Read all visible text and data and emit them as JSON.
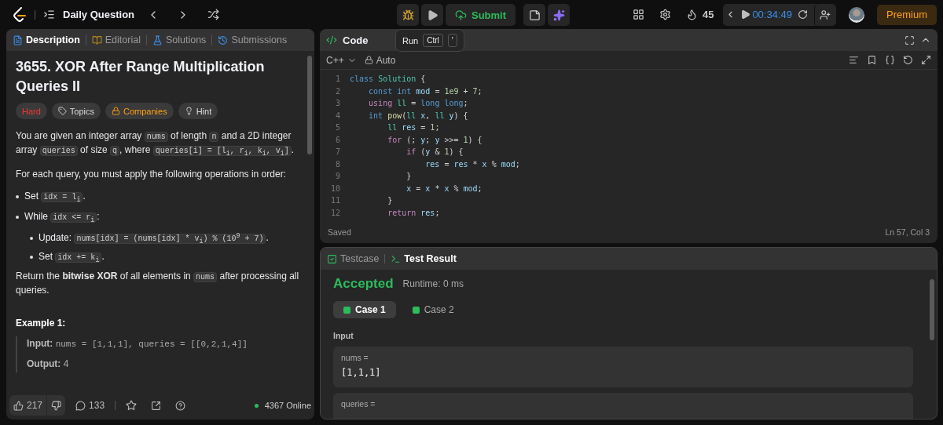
{
  "topbar": {
    "title": "Daily Question",
    "submit": "Submit",
    "streak": "45",
    "timer": "00:34:49",
    "premium": "Premium"
  },
  "tooltip": {
    "label": "Run",
    "keys": [
      "Ctrl",
      "'"
    ]
  },
  "left": {
    "tabs": [
      {
        "label": "Description",
        "selected": true,
        "kind": "description"
      },
      {
        "label": "Editorial",
        "selected": false,
        "kind": "editorial"
      },
      {
        "label": "Solutions",
        "selected": false,
        "kind": "solutions"
      },
      {
        "label": "Submissions",
        "selected": false,
        "kind": "submissions"
      }
    ],
    "title": "3655. XOR After Range Multiplication Queries II",
    "tags": [
      {
        "label": "Hard",
        "kind": "difficulty"
      },
      {
        "label": "Topics",
        "kind": "topics"
      },
      {
        "label": "Companies",
        "kind": "companies"
      },
      {
        "label": "Hint",
        "kind": "hint"
      }
    ],
    "blocks": [
      {
        "kind": "p",
        "segments": [
          {
            "kind": "text",
            "text": "You are given an integer array "
          },
          {
            "kind": "code",
            "text": "nums"
          },
          {
            "kind": "text",
            "text": " of length "
          },
          {
            "kind": "code",
            "text": "n"
          },
          {
            "kind": "text",
            "text": " and a 2D integer array "
          },
          {
            "kind": "code",
            "text": "queries"
          },
          {
            "kind": "text",
            "text": " of size "
          },
          {
            "kind": "code",
            "text": "q"
          },
          {
            "kind": "text",
            "text": ", where "
          },
          {
            "kind": "code",
            "text": "queries[i] = [l$_{i}$, r$_{i}$, k$_{i}$, v$_{i}$]"
          },
          {
            "kind": "text",
            "text": "."
          }
        ]
      },
      {
        "kind": "p",
        "segments": [
          {
            "kind": "text",
            "text": "For each query, you must apply the following operations in order:"
          }
        ]
      },
      {
        "kind": "bullet",
        "segments": [
          {
            "kind": "text",
            "text": "Set "
          },
          {
            "kind": "code",
            "text": "idx = l$_{i}$"
          },
          {
            "kind": "text",
            "text": "."
          }
        ]
      },
      {
        "kind": "bullet",
        "segments": [
          {
            "kind": "text",
            "text": "While "
          },
          {
            "kind": "code",
            "text": "idx <= r$_{i}$"
          },
          {
            "kind": "text",
            "text": ":"
          }
        ],
        "children": [
          {
            "kind": "bullet",
            "segments": [
              {
                "kind": "text",
                "text": "Update: "
              },
              {
                "kind": "code",
                "text": "nums[idx] = (nums[idx] * v$_{i}$) % (10$^{9}$ + 7)"
              },
              {
                "kind": "text",
                "text": "."
              }
            ]
          },
          {
            "kind": "bullet",
            "segments": [
              {
                "kind": "text",
                "text": "Set "
              },
              {
                "kind": "code",
                "text": "idx += k$_{i}$"
              },
              {
                "kind": "text",
                "text": "."
              }
            ]
          }
        ]
      },
      {
        "kind": "p",
        "segments": [
          {
            "kind": "text",
            "text": "Return the **bitwise XOR** of all elements in "
          },
          {
            "kind": "code",
            "text": "nums"
          },
          {
            "kind": "text",
            "text": " after processing all queries."
          }
        ]
      }
    ],
    "example": {
      "title": "Example 1:",
      "lines": [
        {
          "label": "Input:",
          "value": "nums = [1,1,1], queries = [[0,2,1,4]]",
          "kind": "mono"
        },
        {
          "label": "Output:",
          "value": "4",
          "kind": "plain"
        }
      ]
    },
    "footer": {
      "likes": "217",
      "comments": "133",
      "online": "4367 Online"
    }
  },
  "code": {
    "title": "Code",
    "language": "C++",
    "mode": "Auto",
    "lines": [
      {
        "n": "1",
        "tokens": [
          {
            "kind": "kw",
            "text": "class "
          },
          {
            "kind": "type",
            "text": "Solution"
          },
          {
            "kind": "plain",
            "text": " {"
          }
        ]
      },
      {
        "n": "2",
        "tokens": [
          {
            "kind": "kw",
            "text": "    const int "
          },
          {
            "kind": "var",
            "text": "mod"
          },
          {
            "kind": "plain",
            "text": " = "
          },
          {
            "kind": "num",
            "text": "1e9"
          },
          {
            "kind": "plain",
            "text": " + "
          },
          {
            "kind": "num",
            "text": "7"
          },
          {
            "kind": "plain",
            "text": ";"
          }
        ]
      },
      {
        "n": "3",
        "tokens": [
          {
            "kind": "ctl",
            "text": "    using "
          },
          {
            "kind": "type",
            "text": "ll"
          },
          {
            "kind": "plain",
            "text": " = "
          },
          {
            "kind": "kw",
            "text": "long long"
          },
          {
            "kind": "plain",
            "text": ";"
          }
        ]
      },
      {
        "n": "4",
        "tokens": [
          {
            "kind": "kw",
            "text": "    int "
          },
          {
            "kind": "fn",
            "text": "pow"
          },
          {
            "kind": "plain",
            "text": "("
          },
          {
            "kind": "type",
            "text": "ll "
          },
          {
            "kind": "var",
            "text": "x"
          },
          {
            "kind": "plain",
            "text": ", "
          },
          {
            "kind": "type",
            "text": "ll "
          },
          {
            "kind": "var",
            "text": "y"
          },
          {
            "kind": "plain",
            "text": ") {"
          }
        ]
      },
      {
        "n": "5",
        "tokens": [
          {
            "kind": "type",
            "text": "        ll "
          },
          {
            "kind": "var",
            "text": "res"
          },
          {
            "kind": "plain",
            "text": " = "
          },
          {
            "kind": "num",
            "text": "1"
          },
          {
            "kind": "plain",
            "text": ";"
          }
        ]
      },
      {
        "n": "6",
        "tokens": [
          {
            "kind": "ctl",
            "text": "        for"
          },
          {
            "kind": "plain",
            "text": " (; "
          },
          {
            "kind": "var",
            "text": "y"
          },
          {
            "kind": "plain",
            "text": "; "
          },
          {
            "kind": "var",
            "text": "y"
          },
          {
            "kind": "plain",
            "text": " >>= "
          },
          {
            "kind": "num",
            "text": "1"
          },
          {
            "kind": "plain",
            "text": ") {"
          }
        ]
      },
      {
        "n": "7",
        "tokens": [
          {
            "kind": "ctl",
            "text": "            if"
          },
          {
            "kind": "plain",
            "text": " ("
          },
          {
            "kind": "var",
            "text": "y"
          },
          {
            "kind": "plain",
            "text": " & "
          },
          {
            "kind": "num",
            "text": "1"
          },
          {
            "kind": "plain",
            "text": ") {"
          }
        ]
      },
      {
        "n": "8",
        "tokens": [
          {
            "kind": "var",
            "text": "                res"
          },
          {
            "kind": "plain",
            "text": " = "
          },
          {
            "kind": "var",
            "text": "res"
          },
          {
            "kind": "plain",
            "text": " * "
          },
          {
            "kind": "var",
            "text": "x"
          },
          {
            "kind": "plain",
            "text": " % "
          },
          {
            "kind": "var",
            "text": "mod"
          },
          {
            "kind": "plain",
            "text": ";"
          }
        ]
      },
      {
        "n": "9",
        "tokens": [
          {
            "kind": "plain",
            "text": "            }"
          }
        ]
      },
      {
        "n": "10",
        "tokens": [
          {
            "kind": "var",
            "text": "            x"
          },
          {
            "kind": "plain",
            "text": " = "
          },
          {
            "kind": "var",
            "text": "x"
          },
          {
            "kind": "plain",
            "text": " * "
          },
          {
            "kind": "var",
            "text": "x"
          },
          {
            "kind": "plain",
            "text": " % "
          },
          {
            "kind": "var",
            "text": "mod"
          },
          {
            "kind": "plain",
            "text": ";"
          }
        ]
      },
      {
        "n": "11",
        "tokens": [
          {
            "kind": "plain",
            "text": "        }"
          }
        ]
      },
      {
        "n": "12",
        "tokens": [
          {
            "kind": "ctl",
            "text": "        return "
          },
          {
            "kind": "var",
            "text": "res"
          },
          {
            "kind": "plain",
            "text": ";"
          }
        ]
      }
    ],
    "status": "Saved",
    "position": "Ln 57, Col 3"
  },
  "result": {
    "tabs": [
      {
        "label": "Testcase",
        "selected": false,
        "kind": "testcase"
      },
      {
        "label": "Test Result",
        "selected": true,
        "kind": "result"
      }
    ],
    "verdict": "Accepted",
    "runtime": "Runtime: 0 ms",
    "cases": [
      {
        "label": "Case 1",
        "selected": true
      },
      {
        "label": "Case 2",
        "selected": false
      }
    ],
    "section": "Input",
    "fields": [
      {
        "label": "nums =",
        "value": "[1,1,1]"
      },
      {
        "label": "queries ="
      }
    ]
  }
}
